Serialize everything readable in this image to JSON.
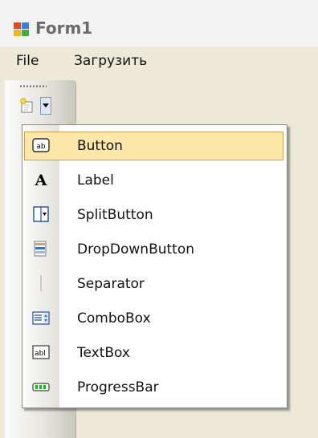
{
  "window": {
    "title": "Form1",
    "title_icon": "form-app-icon"
  },
  "menu": {
    "file": "File",
    "load": "Загрузить"
  },
  "toolstrip": {
    "add_button_icon": "new-item-icon",
    "dropdown_arrow_icon": "chevron-down-icon"
  },
  "dropdown": {
    "items": [
      {
        "label": "Button",
        "icon": "button-icon",
        "selected": true
      },
      {
        "label": "Label",
        "icon": "label-icon",
        "selected": false
      },
      {
        "label": "SplitButton",
        "icon": "splitbutton-icon",
        "selected": false
      },
      {
        "label": "DropDownButton",
        "icon": "dropdownbutton-icon",
        "selected": false
      },
      {
        "label": "Separator",
        "icon": "separator-icon",
        "selected": false
      },
      {
        "label": "ComboBox",
        "icon": "combobox-icon",
        "selected": false
      },
      {
        "label": "TextBox",
        "icon": "textbox-icon",
        "selected": false
      },
      {
        "label": "ProgressBar",
        "icon": "progressbar-icon",
        "selected": false
      }
    ]
  },
  "colors": {
    "highlight_fill": "#fde7a9",
    "highlight_border": "#c9a04b",
    "window_bg": "#ece9d8"
  }
}
